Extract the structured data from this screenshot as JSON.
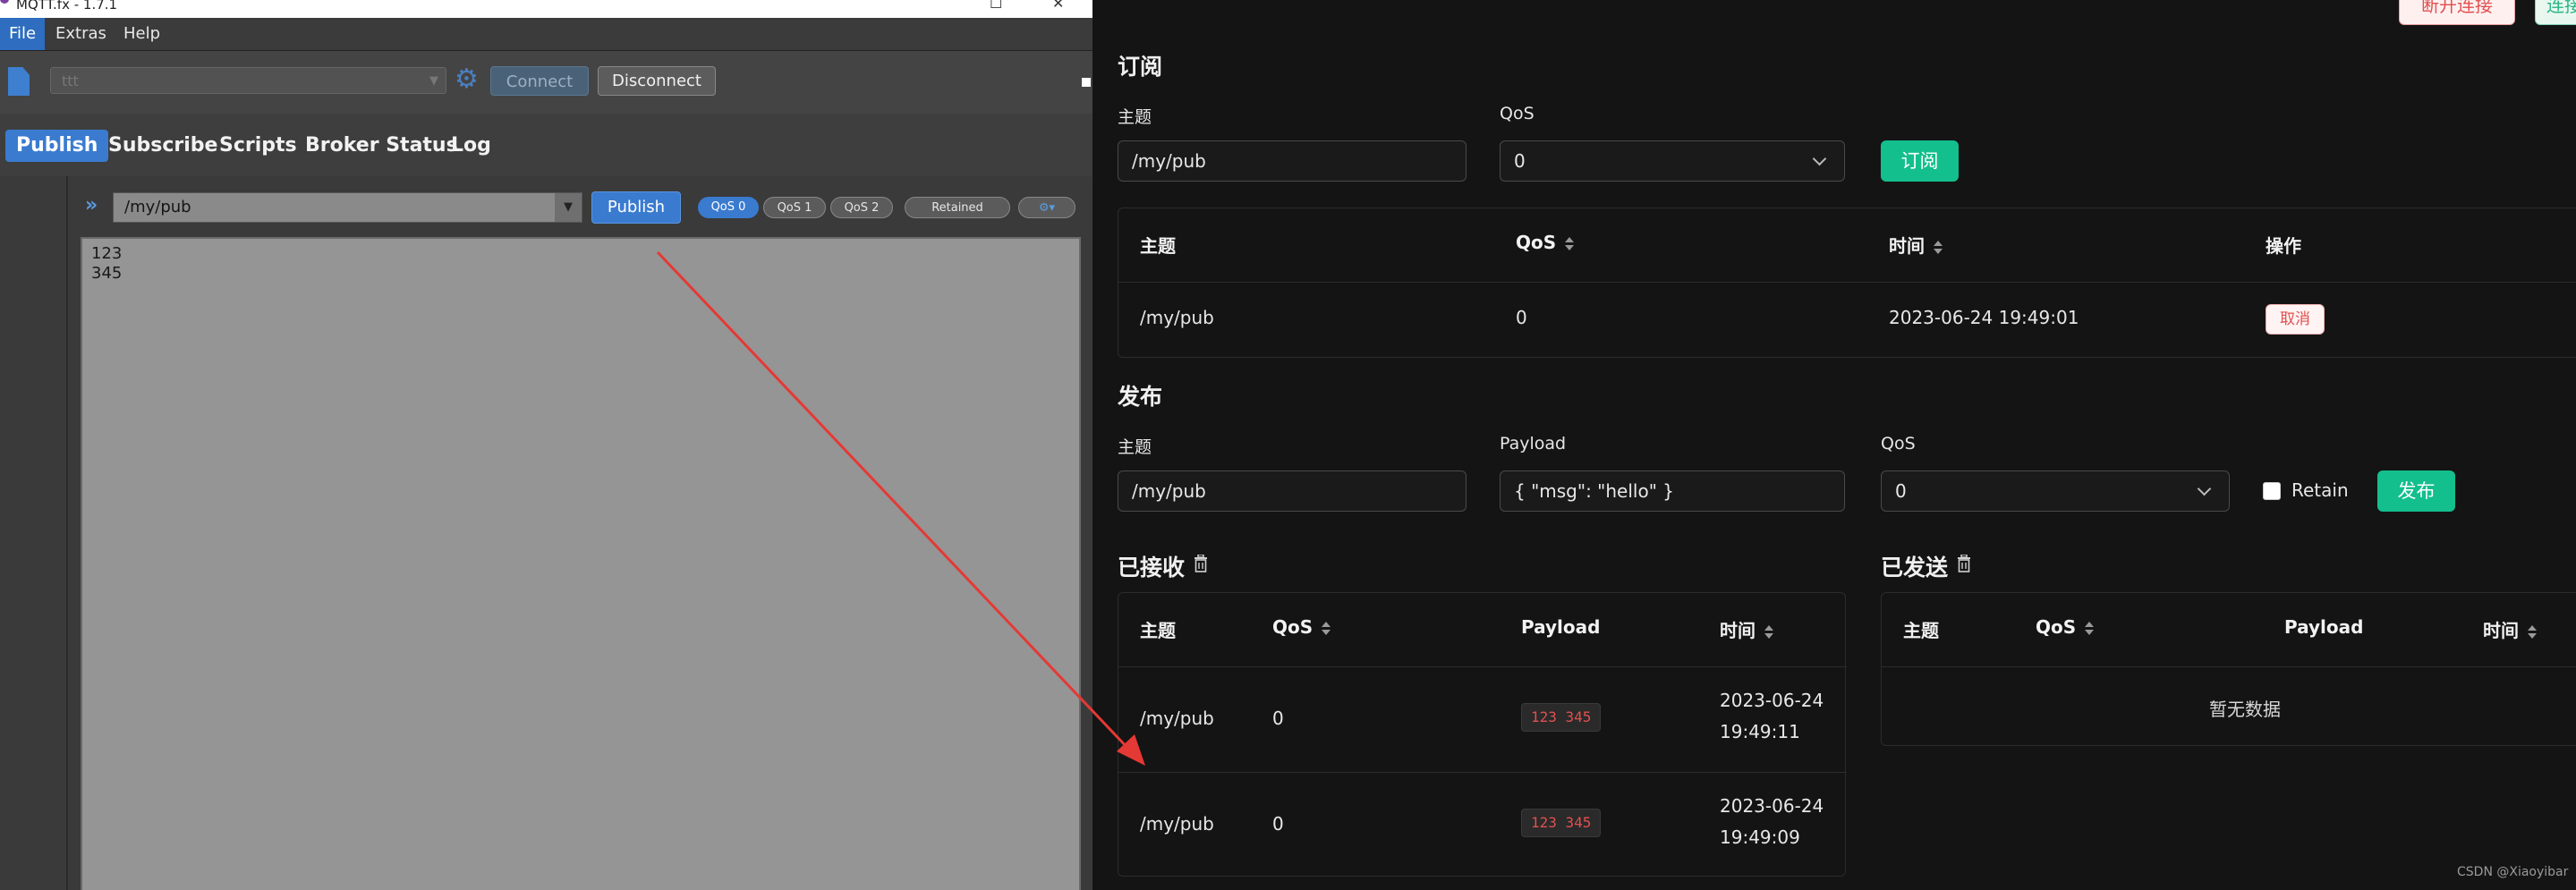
{
  "left_app": {
    "title": "MQTT.fx - 1.7.1",
    "menu": [
      "File",
      "Extras",
      "Help"
    ],
    "toolbar": {
      "profile_value": "ttt",
      "connect_label": "Connect",
      "disconnect_label": "Disconnect"
    },
    "tabs": [
      "Publish",
      "Subscribe",
      "Scripts",
      "Broker Status",
      "Log"
    ],
    "publish": {
      "topic": "/my/pub",
      "publish_label": "Publish",
      "qos_options": [
        "QoS 0",
        "QoS 1",
        "QoS 2"
      ],
      "retained_label": "Retained",
      "payload_lines": [
        "123",
        "345"
      ]
    }
  },
  "right_app": {
    "header": {
      "disconnect_label": "断开连接",
      "connect_label": "连接"
    },
    "subscribe": {
      "title": "订阅",
      "topic_label": "主题",
      "topic_value": "/my/pub",
      "qos_label": "QoS",
      "qos_value": "0",
      "button_label": "订阅",
      "table": {
        "headers": [
          "主题",
          "QoS",
          "时间",
          "操作"
        ],
        "rows": [
          {
            "topic": "/my/pub",
            "qos": "0",
            "time": "2023-06-24 19:49:01",
            "action": "取消"
          }
        ]
      }
    },
    "publish": {
      "title": "发布",
      "topic_label": "主题",
      "topic_value": "/my/pub",
      "payload_label": "Payload",
      "payload_value": "{ \"msg\": \"hello\" }",
      "qos_label": "QoS",
      "qos_value": "0",
      "retain_label": "Retain",
      "button_label": "发布"
    },
    "received": {
      "title": "已接收",
      "headers": [
        "主题",
        "QoS",
        "Payload",
        "时间"
      ],
      "rows": [
        {
          "topic": "/my/pub",
          "qos": "0",
          "payload": "123 345",
          "date": "2023-06-24",
          "time": "19:49:11"
        },
        {
          "topic": "/my/pub",
          "qos": "0",
          "payload": "123 345",
          "date": "2023-06-24",
          "time": "19:49:09"
        }
      ]
    },
    "sent": {
      "title": "已发送",
      "headers": [
        "主题",
        "QoS",
        "Payload",
        "时间"
      ],
      "empty_text": "暂无数据"
    },
    "watermark": "CSDN @Xiaoyibar"
  },
  "colors": {
    "accent_green": "#13bf8d",
    "accent_blue": "#3a7bd0",
    "annotation_arrow": "#e53935"
  }
}
